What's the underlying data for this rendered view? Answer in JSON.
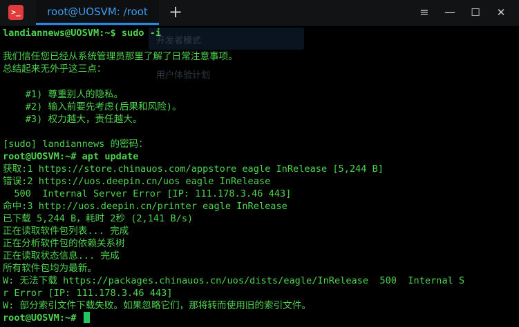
{
  "titlebar": {
    "app_icon": ">_",
    "tab_title": "root@UOSVM: /root",
    "new_tab_glyph": "+",
    "menu_glyph": "≡",
    "minimize_glyph": "—",
    "maximize_glyph": "☐",
    "close_glyph": "✕"
  },
  "background_ghost": {
    "item1": "开发者模式",
    "item2": "用户体验计划"
  },
  "terminal": {
    "lines": [
      "landiannews@UOSVM:~$ sudo -i",
      "",
      "我们信任您已经从系统管理员那里了解了日常注意事项。",
      "总结起来无外乎这三点：",
      "",
      "    #1) 尊重别人的隐私。",
      "    #2) 输入前要先考虑(后果和风险)。",
      "    #3) 权力越大，责任越大。",
      "",
      "[sudo] landiannews 的密码：",
      "root@UOSVM:~# apt update",
      "获取:1 https://store.chinauos.com/appstore eagle InRelease [5,244 B]",
      "错误:2 https://uos.deepin.cn/uos eagle InRelease",
      "  500  Internal Server Error [IP: 111.178.3.46 443]",
      "命中:3 http://uos.deepin.cn/printer eagle InRelease",
      "已下载 5,244 B，耗时 2秒 (2,141 B/s)",
      "正在读取软件包列表... 完成",
      "正在分析软件包的依赖关系树",
      "正在读取状态信息... 完成",
      "所有软件包均为最新。",
      "W: 无法下载 https://packages.chinauos.cn/uos/dists/eagle/InRelease  500  Internal S",
      "r Error [IP: 111.178.3.46 443]",
      "W: 部分索引文件下载失败。如果忽略它们，那将转而使用旧的索引文件。",
      "root@UOSVM:~# "
    ]
  },
  "colors": {
    "terminal_text": "#4fd34f",
    "background": "#000000",
    "tab_accent": "#2a85e8",
    "app_icon_bg": "#e23b3b",
    "cursor": "#22c55e"
  }
}
